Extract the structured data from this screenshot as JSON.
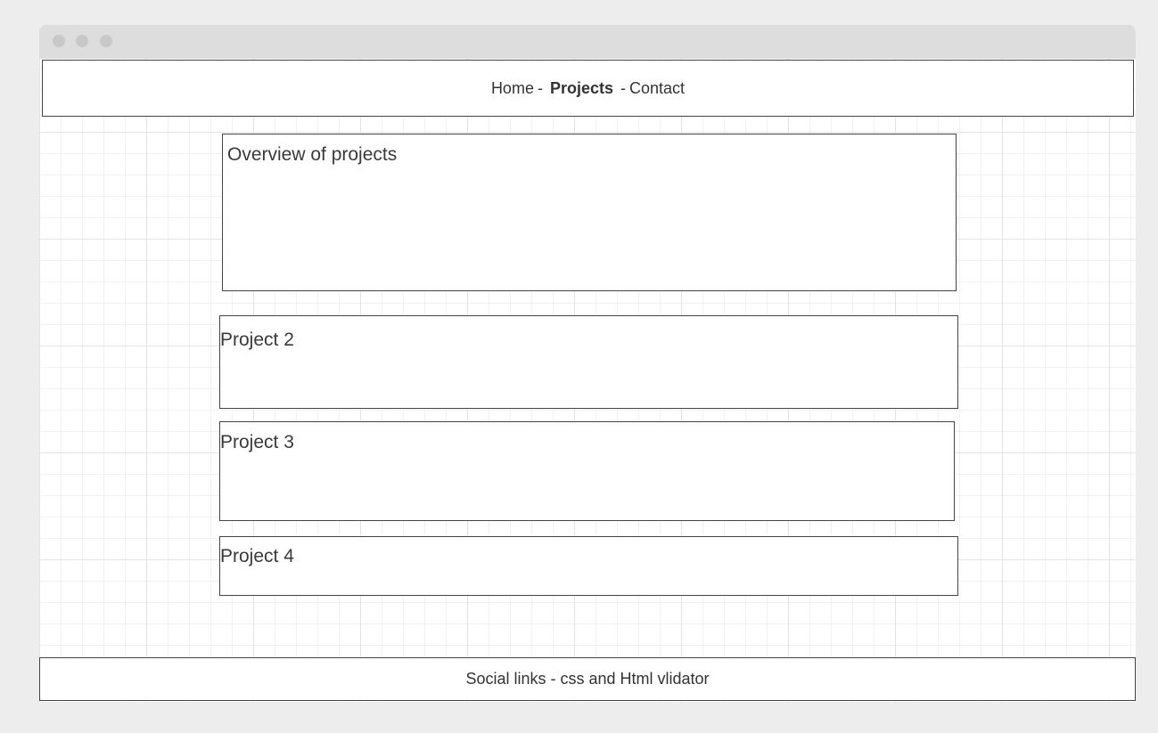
{
  "nav": {
    "home": "Home",
    "separator": "-",
    "projects": "Projects",
    "contact": "Contact"
  },
  "overview": {
    "title": "Overview of projects"
  },
  "projects": [
    {
      "title": "Project 2"
    },
    {
      "title": "Project 3"
    },
    {
      "title": "Project 4"
    }
  ],
  "footer": {
    "text": "Social links - css and Html vlidator"
  },
  "colors": {
    "page_background": "#ededed",
    "titlebar": "#dddddd",
    "border": "#444444",
    "text": "#333333"
  }
}
